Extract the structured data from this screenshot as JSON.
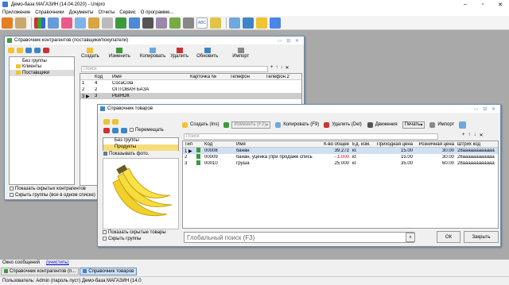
{
  "app": {
    "title": "Демо-база МАГАЗИН (14.04.2020) - Unipro"
  },
  "menu": [
    "Приложение",
    "Справочники",
    "Документы",
    "Отчеты",
    "Сервис",
    "О программе..."
  ],
  "colors": {
    "accent": "#3b7bd4",
    "bg": "#a9a9a9"
  },
  "contragents": {
    "title": "Справочник контрагентов (поставщики/покупатели)",
    "tree": [
      "Без группы",
      "Клиенты",
      "Поставщики"
    ],
    "buttons": {
      "create": "Создать",
      "edit": "Изменить",
      "copy": "Копировать",
      "delete": "Удалить",
      "refresh": "Обновить",
      "import": "Импорт"
    },
    "search_placeholder": "Поиск",
    "columns": [
      "Код",
      "Имя",
      "Карточка №",
      "Телефон",
      "Телефон 2"
    ],
    "rows": [
      {
        "n": "1",
        "code": "4",
        "name": "CocaCola"
      },
      {
        "n": "2",
        "code": "2",
        "name": "ОПТОВАЯ БАЗА"
      },
      {
        "n": "3",
        "code": "3",
        "name": "РЫНОК"
      }
    ],
    "show_hidden": "Показать скрытых контрагентов",
    "hide_groups": "Скрыть группы (все в одном списке)"
  },
  "goods": {
    "title": "Справочник товаров",
    "move": "Перемещать",
    "tree": [
      "Без группы",
      "Продукты"
    ],
    "show_photo": "Показывать фото.",
    "buttons": {
      "create": "Создать (Ins)",
      "edit": "Изменить (F2)",
      "copy": "Копировать (F9)",
      "delete": "Удалить (Del)",
      "moves": "Движения",
      "print": "Печать",
      "import": "Импорт"
    },
    "search_placeholder": "Поиск",
    "columns": [
      "Тип",
      "Код",
      "Имя",
      "К-во общее",
      "Ед. изм.",
      "Приходная цена",
      "Розничная цена",
      "Штрих код"
    ],
    "rows": [
      {
        "marker": "1 ▶",
        "code": "00008",
        "name": "банан",
        "qty": "39.272",
        "unit": "кг.",
        "in_price": "15.00",
        "price": "30.00",
        "barcode": "28aaaaaaaaaaaa"
      },
      {
        "marker": "2",
        "code": "00009",
        "name": "банан, уценка (при продаже списывается б",
        "qty": "- 1.000",
        "unit": "кг.",
        "in_price": "15.00",
        "price": "30.00",
        "barcode": "28aaaaaaaaaaaa"
      },
      {
        "marker": "3",
        "code": "00010",
        "name": "груша",
        "qty": "25.000",
        "unit": "кг.",
        "in_price": "35.00",
        "price": "60.00",
        "barcode": "28aaaaaaaaaaaa"
      }
    ],
    "show_hidden": "Показать скрытые товары",
    "hide_groups": "Скрыть группы",
    "global_search_placeholder": "Глобальный поиск (F3)",
    "ok": "ОК",
    "close": "Закрыть"
  },
  "messages": {
    "label": "Окно сообщений",
    "clear": "(очистить)"
  },
  "tasks": [
    "Справочник контрагентов (п...",
    "Справочник товаров"
  ],
  "status": "Пользователь: Admin (пароль пуст)  Демо-база МАГАЗИН (14.0"
}
